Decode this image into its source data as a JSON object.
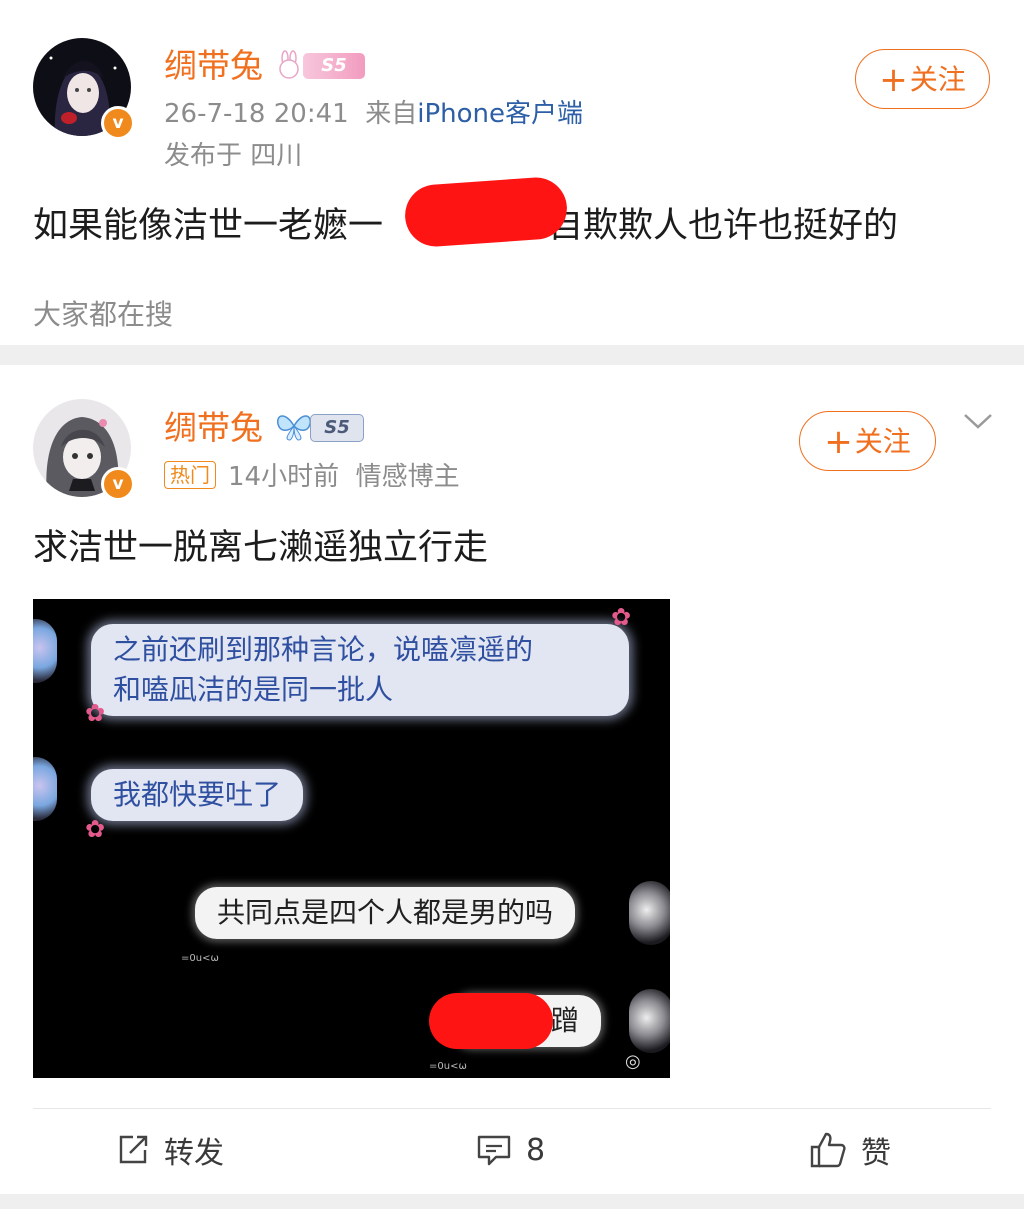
{
  "post1": {
    "username": "绸带兔",
    "level": "S5",
    "time": "26-7-18 20:41",
    "source_prefix": "来自",
    "source": "iPhone客户端",
    "location": "发布于 四川",
    "follow_label": "关注",
    "text_before": "如果能像洁世一老嬷一",
    "text_after": "自欺欺人也许也挺好的",
    "search_hint": "大家都在搜"
  },
  "post2": {
    "username": "绸带兔",
    "level": "S5",
    "hot_tag": "热门",
    "time": "14小时前",
    "tag": "情感博主",
    "follow_label": "关注",
    "text": "求洁世一脱离七濑遥独立行走",
    "image": {
      "bubble1": "之前还刷到那种言论，说嗑凛遥的\n和嗑凪洁的是同一批人",
      "bubble2": "我都快要吐了",
      "bubble3": "共同点是四个人都是男的吗",
      "bubble4_visible": "蹭"
    }
  },
  "actions": {
    "repost_label": "转发",
    "comment_count": "8",
    "like_label": "赞"
  },
  "colors": {
    "username": "#f0701f",
    "follow": "#f0701f",
    "source_link": "#2d5fa6",
    "verified_badge": "#f08a1c"
  }
}
